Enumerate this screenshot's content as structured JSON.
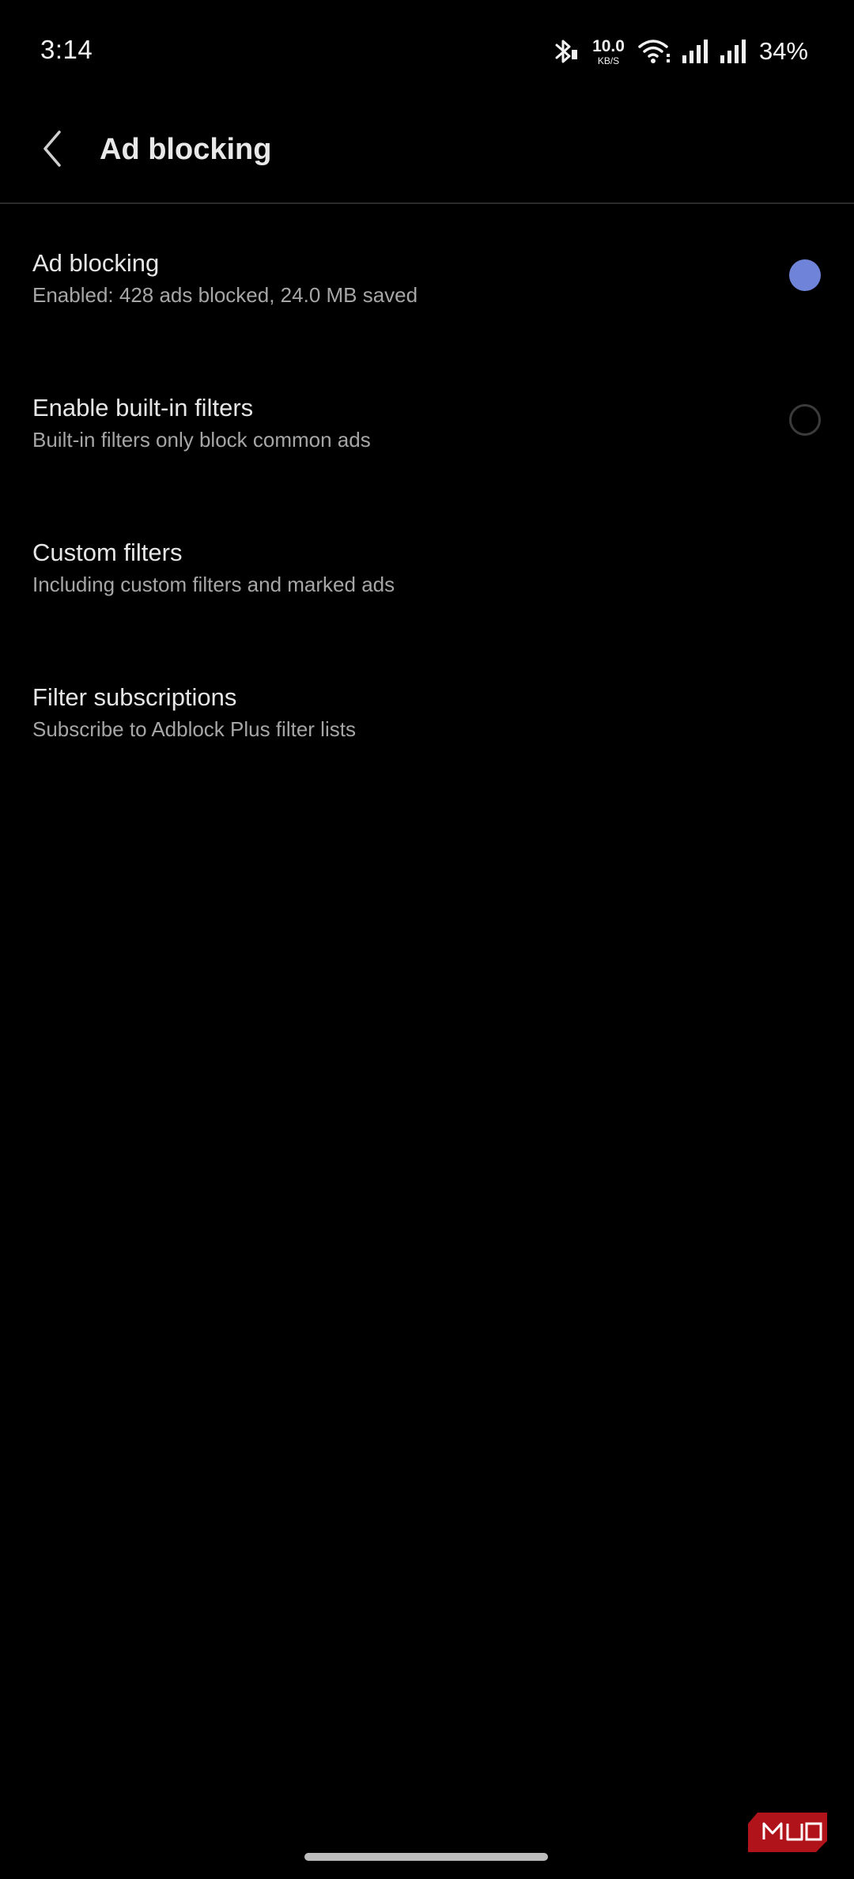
{
  "status_bar": {
    "time": "3:14",
    "net_speed_value": "10.0",
    "net_speed_unit": "KB/S",
    "battery": "34%",
    "icons": [
      "bluetooth-icon",
      "wifi-icon",
      "signal-icon",
      "signal-icon"
    ]
  },
  "app_bar": {
    "back_icon": "chevron-left-icon",
    "title": "Ad blocking"
  },
  "settings": [
    {
      "title": "Ad blocking",
      "subtitle": "Enabled: 428 ads blocked, 24.0 MB saved",
      "control": "radio",
      "selected": true
    },
    {
      "title": "Enable built-in filters",
      "subtitle": "Built-in filters only block common ads",
      "control": "radio",
      "selected": false
    },
    {
      "title": "Custom filters",
      "subtitle": "Including custom filters and marked ads"
    },
    {
      "title": "Filter subscriptions",
      "subtitle": "Subscribe to Adblock Plus filter lists"
    }
  ],
  "watermark": {
    "text": "MUO"
  },
  "colors": {
    "background": "#000000",
    "accent": "#6f84d8",
    "primary_text": "#e6e6e6",
    "secondary_text": "#a6a6a6",
    "watermark": "#b0141a"
  }
}
